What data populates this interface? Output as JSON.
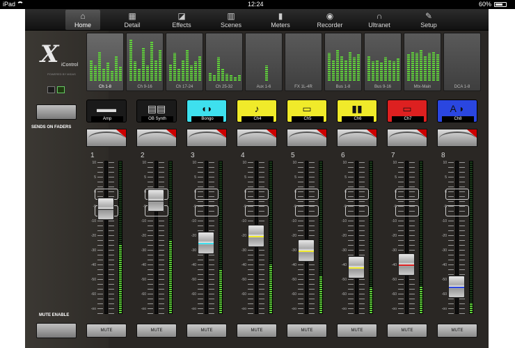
{
  "status": {
    "device": "iPad",
    "time": "12:24",
    "battery": "60%"
  },
  "nav": {
    "tabs": [
      {
        "label": "Home",
        "icon": "home-icon",
        "glyph": "⌂"
      },
      {
        "label": "Detail",
        "icon": "detail-icon",
        "glyph": "▦"
      },
      {
        "label": "Effects",
        "icon": "effects-icon",
        "glyph": "◪"
      },
      {
        "label": "Scenes",
        "icon": "scenes-icon",
        "glyph": "▥"
      },
      {
        "label": "Meters",
        "icon": "meters-icon",
        "glyph": "▮"
      },
      {
        "label": "Recorder",
        "icon": "recorder-icon",
        "glyph": "◉"
      },
      {
        "label": "Ultranet",
        "icon": "headphones-icon",
        "glyph": "∩"
      },
      {
        "label": "Setup",
        "icon": "setup-icon",
        "glyph": "✎"
      }
    ],
    "active": "Home"
  },
  "sidebar": {
    "logo_x": "X",
    "logo_name": "iControl",
    "logo_sub": "POWERED BY MIDAS",
    "sends_label": "SENDS ON FADERS",
    "mute_enable_label": "MUTE ENABLE"
  },
  "meter_tiles": [
    "Ch 1-8",
    "Ch 9-16",
    "Ch 17-24",
    "Ch 25-32",
    "Aux 1-6",
    "FX 1L-4R",
    "Bus 1-8",
    "Bus 9-16",
    "Mtx-Main",
    "DCA 1-8"
  ],
  "channels": [
    {
      "num": "1",
      "name": "Amp",
      "color": "#1a1a1a",
      "glyph": "▬▬",
      "fader": 0.72,
      "level": 0.72
    },
    {
      "num": "2",
      "name": "OB Synth",
      "color": "#1a1a1a",
      "glyph": "▤▤",
      "fader": 0.78,
      "level": 0.78
    },
    {
      "num": "3",
      "name": "Bongo",
      "color": "#3ee0ee",
      "glyph": "◖◗",
      "fader": 0.46,
      "level": 0.46
    },
    {
      "num": "4",
      "name": "Ch4",
      "color": "#f0ea2a",
      "glyph": "♪",
      "fader": 0.51,
      "level": 0.51
    },
    {
      "num": "5",
      "name": "Ch5",
      "color": "#f0ea2a",
      "glyph": "▭",
      "fader": 0.4,
      "level": 0.4
    },
    {
      "num": "6",
      "name": "Ch6",
      "color": "#f0ea2a",
      "glyph": "▮▮",
      "fader": 0.27,
      "level": 0.27
    },
    {
      "num": "7",
      "name": "Ch7",
      "color": "#dd2020",
      "glyph": "▭",
      "fader": 0.29,
      "level": 0.29
    },
    {
      "num": "8",
      "name": "Ch8",
      "color": "#2a46e0",
      "glyph": "A ◗",
      "fader": 0.12,
      "level": 0.12
    }
  ],
  "scale": [
    "10",
    "5",
    "0",
    "-5",
    "-10",
    "-20",
    "-30",
    "-40",
    "-50",
    "-60",
    "-oo"
  ],
  "mute_label": "MUTE"
}
